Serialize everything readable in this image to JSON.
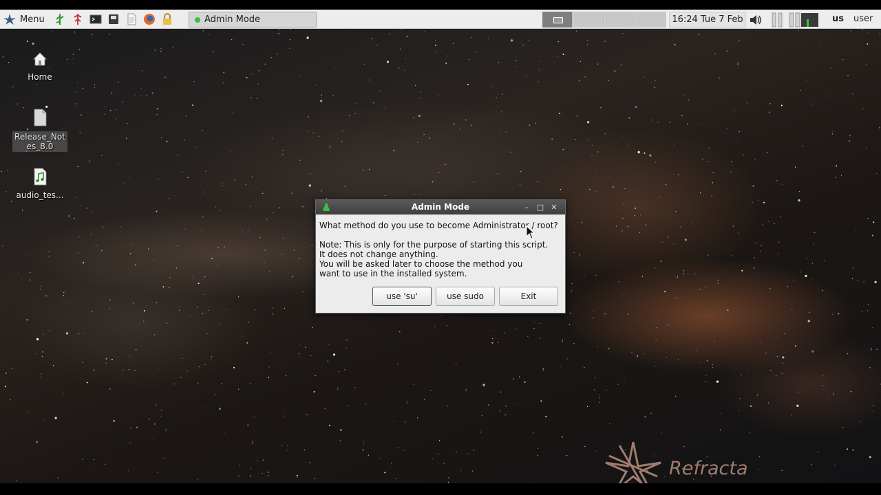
{
  "panel": {
    "menu_label": "Menu",
    "launchers": [
      "network-icon",
      "pin-icon",
      "terminal-icon",
      "disk-icon",
      "file-manager-icon",
      "firefox-icon",
      "lock-icon"
    ],
    "task_label": "Admin Mode",
    "clock": "16:24  Tue  7 Feb",
    "keyboard_layout": "us",
    "user": "user"
  },
  "desktop": {
    "icons": [
      {
        "name": "home-icon",
        "label": "Home"
      },
      {
        "name": "text-file-icon",
        "label": "Release_Notes_8.0"
      },
      {
        "name": "audio-file-icon",
        "label": "audio_tes..."
      }
    ],
    "brand": "Refracta"
  },
  "dialog": {
    "title": "Admin Mode",
    "question": "What method do you use to become Administrator / root?",
    "note": "Note: This is only for the purpose of starting this script.\nIt does not change anything.\nYou will be asked later to choose the method you\nwant to use in the installed system.",
    "buttons": {
      "su": "use 'su'",
      "sudo": "use sudo",
      "exit": "Exit"
    }
  },
  "colors": {
    "titlebar": "#4a4a4a",
    "panel": "#ededed",
    "accent": "#3fbf3f"
  }
}
